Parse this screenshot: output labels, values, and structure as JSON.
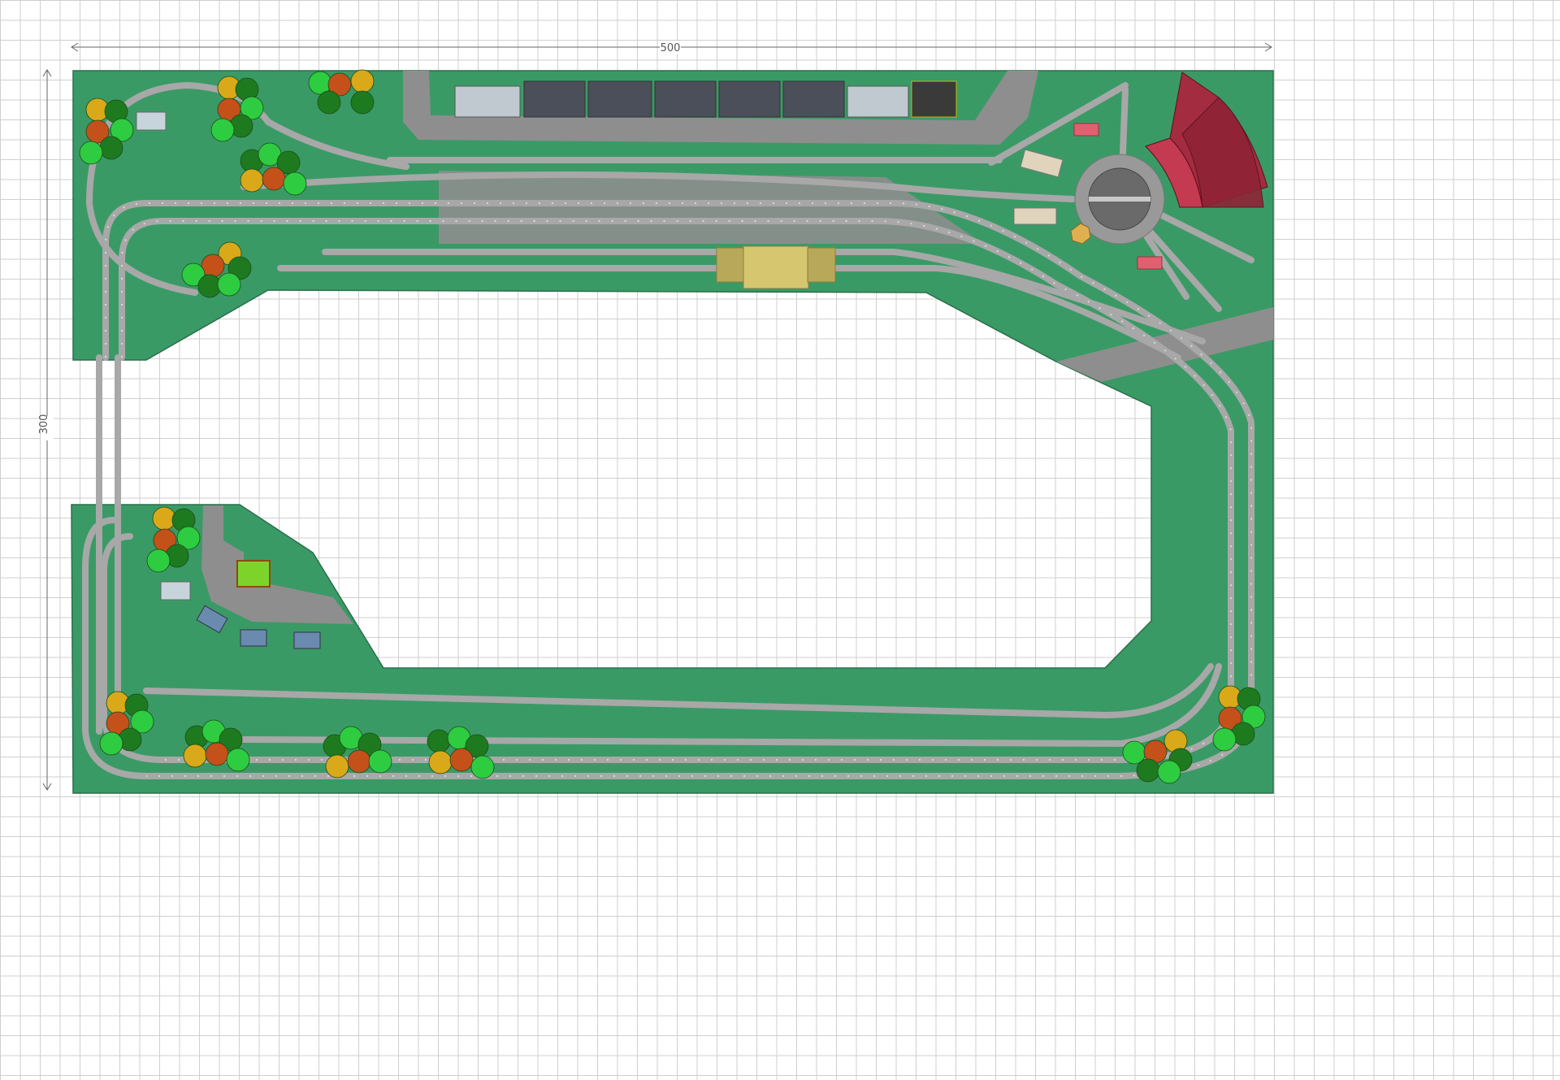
{
  "dimensions": {
    "width_label": "500",
    "height_label": "300"
  },
  "colors": {
    "baseboard": "#3a9a66",
    "track": "#a8a8a8",
    "road": "#8e8e8e",
    "roundhouse": "#a32c40",
    "station": "#d6c66f",
    "tree_dark": "#1e7a1e",
    "tree_light": "#2ecc40",
    "tree_orange": "#c4501a",
    "tree_yellow": "#d9a91a"
  },
  "items": {
    "roundhouse_stalls": 3,
    "turntable": "turntable-icon",
    "station": "station-building-icon",
    "tree": "tree-icon",
    "house": "house-icon"
  }
}
